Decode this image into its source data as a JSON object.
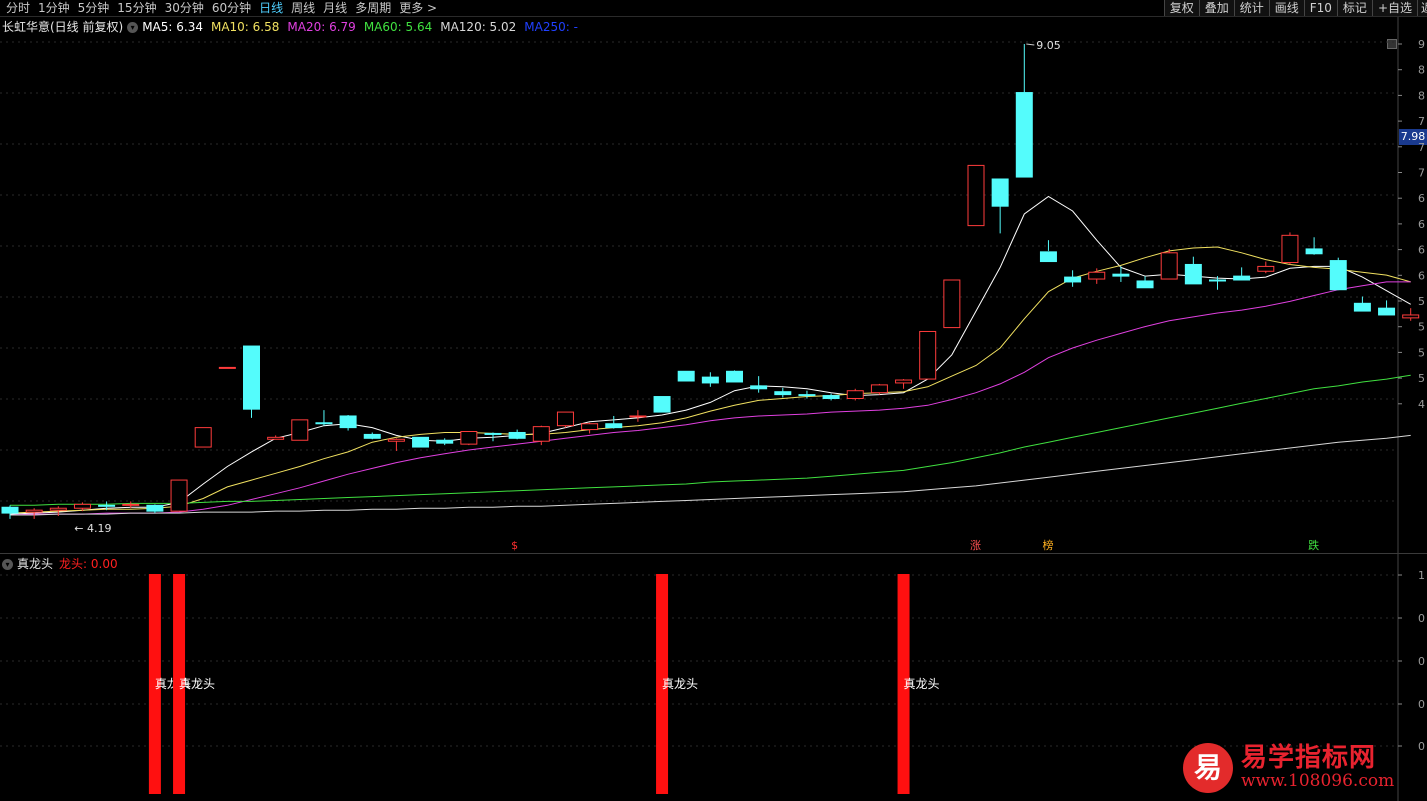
{
  "period_tabs": [
    "分时",
    "1分钟",
    "5分钟",
    "15分钟",
    "30分钟",
    "60分钟",
    "日线",
    "周线",
    "月线",
    "多周期",
    "更多 >"
  ],
  "active_tab": "日线",
  "toolbar": [
    "复权",
    "叠加",
    "统计",
    "画线",
    "F10",
    "标记",
    "+自选",
    "返"
  ],
  "main_chart": {
    "stock_title": "长虹华意(日线 前复权)",
    "ma_legend": [
      {
        "label": "MA5: 6.34",
        "color": "#ffffff"
      },
      {
        "label": "MA10: 6.58",
        "color": "#f0e060"
      },
      {
        "label": "MA20: 6.79",
        "color": "#e040e0"
      },
      {
        "label": "MA60: 5.64",
        "color": "#40e040"
      },
      {
        "label": "MA120: 5.02",
        "color": "#d8d8d8"
      },
      {
        "label": "MA250: -",
        "color": "#2040ff"
      }
    ],
    "high_label": "9.05",
    "low_label": "4.19",
    "current_price": "7.98",
    "y_axis_ticks": [
      "9",
      "8",
      "8",
      "7",
      "7",
      "7",
      "6",
      "6",
      "6",
      "6",
      "5",
      "5",
      "5",
      "5",
      "4"
    ],
    "markers": [
      {
        "text": "$",
        "color": "#ff3030"
      },
      {
        "text": "涨",
        "color": "#ff5050"
      },
      {
        "text": "榜",
        "color": "#ffb020"
      },
      {
        "text": "跌",
        "color": "#40e040"
      }
    ]
  },
  "chart_data": {
    "type": "candlestick",
    "series": [
      {
        "name": "candles",
        "values": [
          [
            4.28,
            4.3,
            4.16,
            4.22
          ],
          [
            4.23,
            4.27,
            4.16,
            4.25
          ],
          [
            4.25,
            4.29,
            4.19,
            4.27
          ],
          [
            4.27,
            4.33,
            4.24,
            4.31
          ],
          [
            4.3,
            4.34,
            4.25,
            4.29
          ],
          [
            4.3,
            4.34,
            4.27,
            4.31
          ],
          [
            4.3,
            4.31,
            4.22,
            4.24
          ],
          [
            4.24,
            4.56,
            4.24,
            4.56
          ],
          [
            4.9,
            5.1,
            4.9,
            5.1
          ],
          [
            5.72,
            5.72,
            5.72,
            5.72
          ],
          [
            5.94,
            5.94,
            5.2,
            5.29
          ],
          [
            4.98,
            5.02,
            4.98,
            5.0
          ],
          [
            4.97,
            5.18,
            4.97,
            5.18
          ],
          [
            5.15,
            5.28,
            5.12,
            5.14
          ],
          [
            5.22,
            5.23,
            5.07,
            5.1
          ],
          [
            5.03,
            5.05,
            4.98,
            4.99
          ],
          [
            4.96,
            4.99,
            4.86,
            4.98
          ],
          [
            5.0,
            5.0,
            4.9,
            4.9
          ],
          [
            4.97,
            4.99,
            4.92,
            4.94
          ],
          [
            4.93,
            5.06,
            4.92,
            5.06
          ],
          [
            5.04,
            5.05,
            4.96,
            5.03
          ],
          [
            5.05,
            5.08,
            4.98,
            4.99
          ],
          [
            4.96,
            5.12,
            4.92,
            5.11
          ],
          [
            5.12,
            5.26,
            5.1,
            5.26
          ],
          [
            5.08,
            5.15,
            5.04,
            5.14
          ],
          [
            5.14,
            5.22,
            5.09,
            5.1
          ],
          [
            5.22,
            5.28,
            5.16,
            5.22
          ],
          [
            5.42,
            5.42,
            5.28,
            5.26
          ],
          [
            5.68,
            5.68,
            5.58,
            5.58
          ],
          [
            5.62,
            5.67,
            5.52,
            5.56
          ],
          [
            5.68,
            5.69,
            5.57,
            5.57
          ],
          [
            5.53,
            5.63,
            5.46,
            5.5
          ],
          [
            5.47,
            5.51,
            5.41,
            5.44
          ],
          [
            5.44,
            5.48,
            5.4,
            5.43
          ],
          [
            5.43,
            5.45,
            5.38,
            5.4
          ],
          [
            5.4,
            5.5,
            5.38,
            5.48
          ],
          [
            5.46,
            5.55,
            5.44,
            5.54
          ],
          [
            5.56,
            5.6,
            5.5,
            5.59
          ],
          [
            5.6,
            6.09,
            5.6,
            6.09
          ],
          [
            6.13,
            6.62,
            6.13,
            6.62
          ],
          [
            7.18,
            7.8,
            7.18,
            7.8
          ],
          [
            7.66,
            7.66,
            7.1,
            7.38
          ],
          [
            8.55,
            9.05,
            7.7,
            7.68
          ],
          [
            6.91,
            7.03,
            6.92,
            6.81
          ],
          [
            6.65,
            6.72,
            6.55,
            6.6
          ],
          [
            6.63,
            6.74,
            6.58,
            6.7
          ],
          [
            6.68,
            6.76,
            6.6,
            6.66
          ],
          [
            6.61,
            6.66,
            6.57,
            6.54
          ],
          [
            6.63,
            6.94,
            6.63,
            6.9
          ],
          [
            6.78,
            6.86,
            6.58,
            6.58
          ],
          [
            6.62,
            6.66,
            6.52,
            6.61
          ],
          [
            6.66,
            6.75,
            6.62,
            6.62
          ],
          [
            6.71,
            6.81,
            6.69,
            6.76
          ],
          [
            6.8,
            7.11,
            6.78,
            7.08
          ],
          [
            6.94,
            7.06,
            6.88,
            6.89
          ],
          [
            6.82,
            6.85,
            6.52,
            6.52
          ],
          [
            6.38,
            6.45,
            6.3,
            6.3
          ],
          [
            6.33,
            6.41,
            6.27,
            6.26
          ],
          [
            6.23,
            6.33,
            6.2,
            6.26
          ]
        ]
      },
      {
        "name": "MA5",
        "values": [
          4.21,
          4.22,
          4.23,
          4.25,
          4.27,
          4.28,
          4.28,
          4.33,
          4.52,
          4.7,
          4.85,
          4.99,
          5.05,
          5.12,
          5.14,
          5.1,
          5.02,
          4.97,
          4.96,
          4.99,
          5.0,
          5.02,
          5.04,
          5.1,
          5.16,
          5.18,
          5.2,
          5.23,
          5.28,
          5.36,
          5.48,
          5.53,
          5.52,
          5.5,
          5.46,
          5.43,
          5.44,
          5.46,
          5.6,
          5.85,
          6.3,
          6.75,
          7.3,
          7.48,
          7.33,
          7.03,
          6.75,
          6.66,
          6.68,
          6.66,
          6.64,
          6.63,
          6.65,
          6.74,
          6.76,
          6.76,
          6.65,
          6.51,
          6.37
        ]
      },
      {
        "name": "MA10",
        "values": [
          4.22,
          4.23,
          4.24,
          4.25,
          4.26,
          4.26,
          4.27,
          4.29,
          4.37,
          4.49,
          4.56,
          4.63,
          4.7,
          4.78,
          4.85,
          4.95,
          5.0,
          5.03,
          5.05,
          5.05,
          5.04,
          5.03,
          5.03,
          5.05,
          5.08,
          5.1,
          5.12,
          5.15,
          5.2,
          5.27,
          5.33,
          5.38,
          5.4,
          5.42,
          5.43,
          5.45,
          5.46,
          5.47,
          5.52,
          5.63,
          5.74,
          5.92,
          6.22,
          6.5,
          6.64,
          6.71,
          6.77,
          6.85,
          6.92,
          6.95,
          6.96,
          6.9,
          6.83,
          6.78,
          6.75,
          6.73,
          6.7,
          6.67,
          6.6
        ]
      },
      {
        "name": "MA20",
        "values": [
          4.2,
          4.21,
          4.21,
          4.21,
          4.22,
          4.22,
          4.22,
          4.23,
          4.26,
          4.3,
          4.36,
          4.42,
          4.48,
          4.55,
          4.62,
          4.68,
          4.74,
          4.79,
          4.83,
          4.87,
          4.9,
          4.93,
          4.96,
          4.99,
          5.02,
          5.05,
          5.07,
          5.1,
          5.13,
          5.17,
          5.2,
          5.22,
          5.23,
          5.24,
          5.26,
          5.27,
          5.28,
          5.3,
          5.33,
          5.39,
          5.46,
          5.55,
          5.67,
          5.82,
          5.92,
          6.0,
          6.07,
          6.14,
          6.2,
          6.24,
          6.28,
          6.31,
          6.35,
          6.4,
          6.46,
          6.52,
          6.56,
          6.6,
          6.6
        ]
      },
      {
        "name": "MA60",
        "values": [
          4.3,
          4.3,
          4.31,
          4.31,
          4.31,
          4.32,
          4.32,
          4.32,
          4.33,
          4.34,
          4.34,
          4.35,
          4.36,
          4.37,
          4.38,
          4.39,
          4.4,
          4.41,
          4.42,
          4.43,
          4.44,
          4.45,
          4.46,
          4.47,
          4.48,
          4.49,
          4.5,
          4.51,
          4.52,
          4.54,
          4.55,
          4.56,
          4.57,
          4.58,
          4.6,
          4.62,
          4.64,
          4.66,
          4.7,
          4.74,
          4.79,
          4.84,
          4.9,
          4.95,
          5.0,
          5.05,
          5.1,
          5.15,
          5.2,
          5.25,
          5.3,
          5.35,
          5.4,
          5.45,
          5.5,
          5.53,
          5.57,
          5.6,
          5.64
        ]
      },
      {
        "name": "MA120",
        "values": [
          4.2,
          4.2,
          4.21,
          4.21,
          4.21,
          4.22,
          4.22,
          4.22,
          4.23,
          4.23,
          4.23,
          4.24,
          4.24,
          4.25,
          4.25,
          4.26,
          4.26,
          4.27,
          4.27,
          4.28,
          4.28,
          4.29,
          4.29,
          4.3,
          4.31,
          4.32,
          4.33,
          4.34,
          4.35,
          4.36,
          4.37,
          4.38,
          4.39,
          4.4,
          4.41,
          4.42,
          4.43,
          4.44,
          4.46,
          4.48,
          4.5,
          4.53,
          4.56,
          4.59,
          4.62,
          4.65,
          4.68,
          4.71,
          4.74,
          4.77,
          4.8,
          4.83,
          4.86,
          4.89,
          4.92,
          4.95,
          4.97,
          4.99,
          5.02
        ]
      }
    ],
    "signal_indices": [
      6,
      7,
      27,
      37
    ],
    "signal_label": "真龙头"
  },
  "sub_chart": {
    "indicator_name": "真龙头",
    "value_label": "龙头: 0.00",
    "y_axis_ticks": [
      "1",
      "0",
      "0",
      "0",
      "0"
    ]
  },
  "watermark": {
    "icon_char": "易",
    "title": "易学指标网",
    "url": "www.108096.com"
  }
}
